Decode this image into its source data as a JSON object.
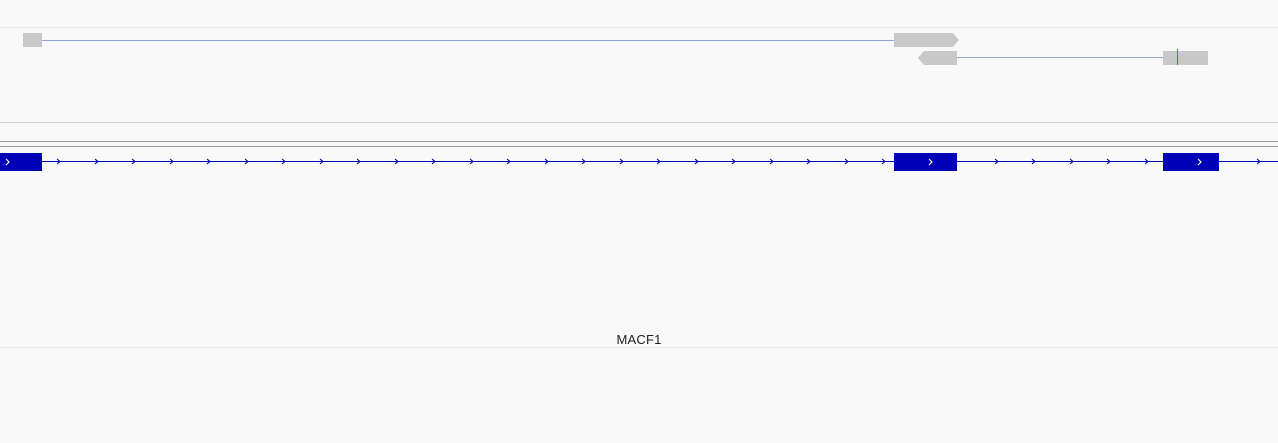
{
  "viewer": {
    "gene_label": "MACF1",
    "colors": {
      "background": "#f9f9f9",
      "track_border": "#e8e8e8",
      "panel_divider": "#cfcfcf",
      "panel_line": "#999999",
      "faded_feature": "#c8c8c8",
      "faded_intron": "#8fa8d8",
      "faded_marker": "#4a6ecf",
      "gene_feature": "#0000b4",
      "gene_arrow": "#ffffff"
    }
  },
  "tracks": {
    "faded_transcripts": {
      "feature_color_name": "light-gray",
      "strands": [
        "+",
        "-"
      ]
    },
    "gene_track": {
      "gene_name": "MACF1",
      "strand": "+",
      "feature_color_name": "dark-blue"
    }
  }
}
